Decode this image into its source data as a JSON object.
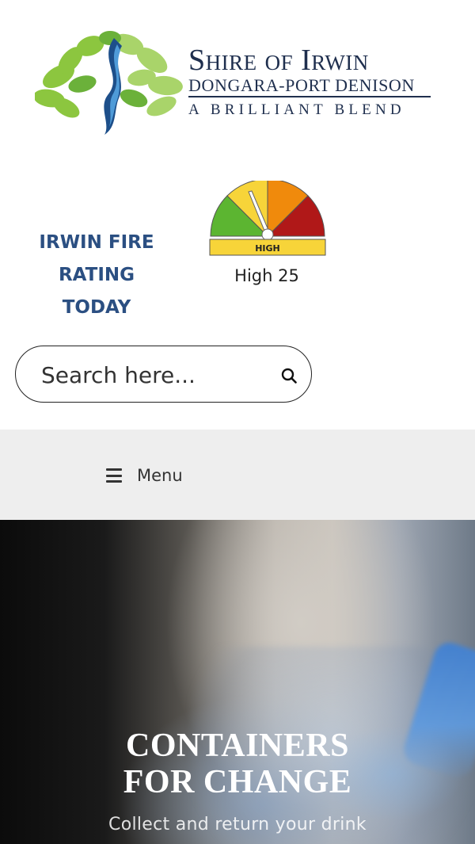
{
  "logo": {
    "title": "Shire of Irwin",
    "subtitle": "DONGARA-PORT DENISON",
    "tagline": "A BRILLIANT BLEND"
  },
  "fire": {
    "label_lines": [
      "IRWIN FIRE",
      "RATING",
      "TODAY"
    ],
    "gauge_text": "HIGH",
    "caption": "High 25"
  },
  "search": {
    "placeholder": "Search here..."
  },
  "menu": {
    "label": "Menu"
  },
  "hero": {
    "title_lines": [
      "CONTAINERS",
      "FOR CHANGE"
    ],
    "subtitle": "Collect and return your drink"
  },
  "colors": {
    "brand_navy": "#1f2f4e",
    "fire_label_blue": "#2b4f82",
    "menu_bg": "#eeeeee"
  }
}
